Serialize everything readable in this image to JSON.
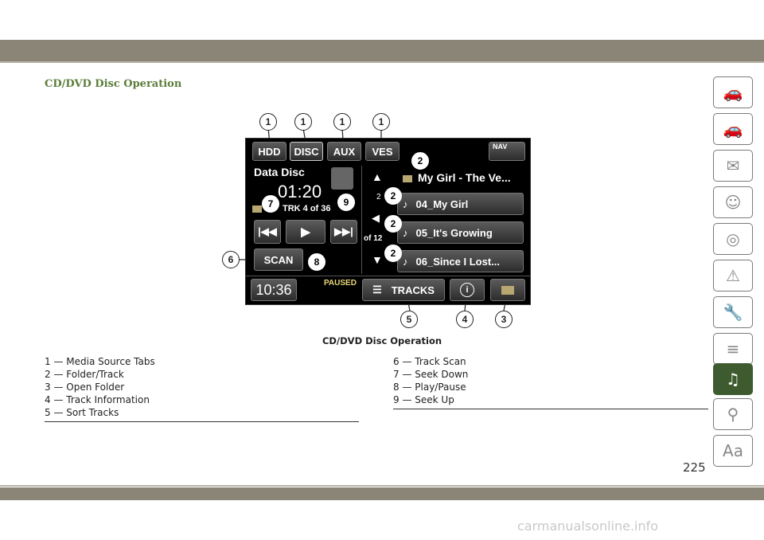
{
  "page": {
    "title": "CD/DVD Disc Operation",
    "caption": "CD/DVD Disc Operation",
    "page_number": "225",
    "watermark": "carmanualsonline.info"
  },
  "legend_left": [
    "1 — Media Source Tabs",
    "2 — Folder/Track",
    "3 — Open Folder",
    "4 — Track Information",
    "5 — Sort Tracks"
  ],
  "legend_right": [
    "6 — Track Scan",
    "7 — Seek Down",
    "8 — Play/Pause",
    "9 — Seek Up"
  ],
  "screen": {
    "tabs": [
      "HDD",
      "DISC",
      "AUX",
      "VES"
    ],
    "nav_label": "NAV",
    "source_name": "Data Disc",
    "elapsed": "01:20",
    "track_info": "TRK 4 of 36",
    "folder_title": "My Girl - The Ve...",
    "folder_num": "2",
    "tracks": [
      "04_My Girl",
      "05_It's Growing",
      "06_Since I Lost..."
    ],
    "of_label": "of 12",
    "scan_label": "SCAN",
    "clock": "10:36",
    "status": "PAUSED",
    "tracks_label": "TRACKS",
    "info_glyph": "i"
  },
  "callouts": {
    "c1": "1",
    "c2": "2",
    "c3": "3",
    "c4": "4",
    "c5": "5",
    "c6": "6",
    "c7": "7",
    "c8": "8",
    "c9": "9"
  },
  "side_icons": [
    "car-info-icon",
    "warning-lights-icon",
    "airbag-icon",
    "driving-icon",
    "steering-icon",
    "emergency-icon",
    "maintenance-icon",
    "specs-icon",
    "multimedia-icon",
    "search-icon",
    "index-icon"
  ]
}
